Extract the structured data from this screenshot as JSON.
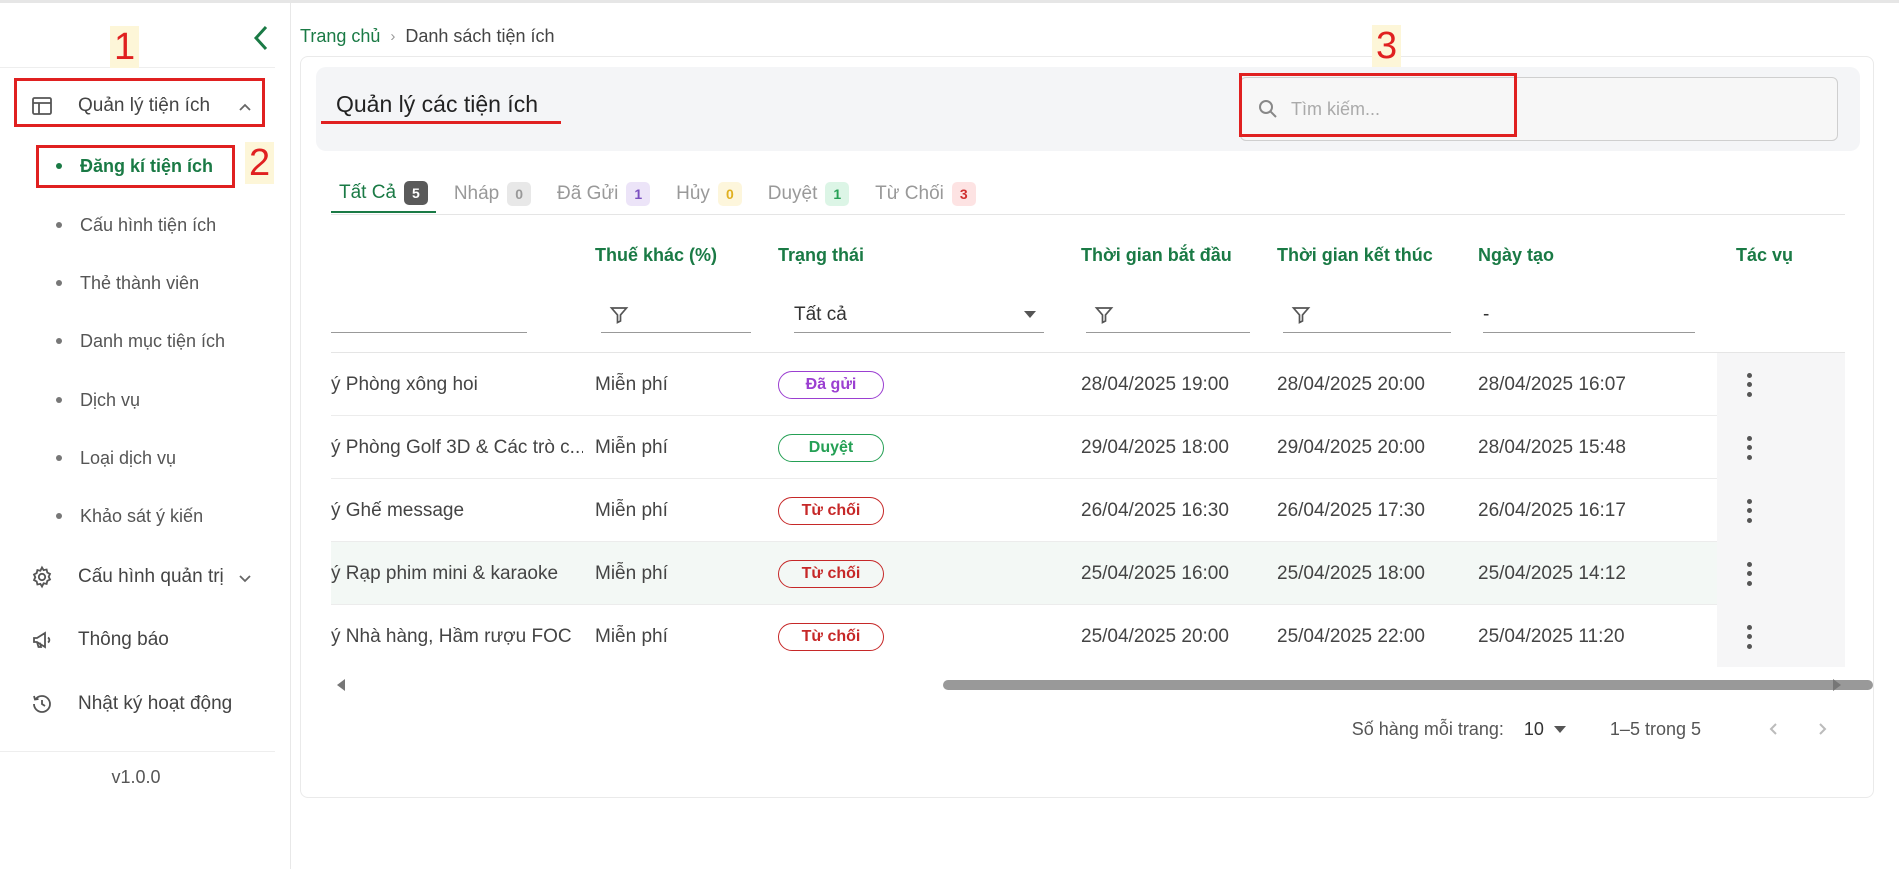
{
  "breadcrumb": {
    "home": "Trang chủ",
    "current": "Danh sách tiện ích"
  },
  "sidebar": {
    "menu_utility": "Quản lý tiện ích",
    "sub_items": [
      "Đăng kí tiện ích",
      "Cấu hình tiện ích",
      "Thẻ thành viên",
      "Danh mục tiện ích",
      "Dịch vụ",
      "Loại dịch vụ",
      "Khảo sát ý kiến"
    ],
    "menu_admin": "Cấu hình quản trị",
    "menu_notify": "Thông báo",
    "menu_log": "Nhật ký hoạt động",
    "version": "v1.0.0"
  },
  "annotations": [
    "1",
    "2",
    "3"
  ],
  "header": {
    "title": "Quản lý các tiện ích",
    "search_placeholder": "Tìm kiếm..."
  },
  "tabs": [
    {
      "label": "Tất Cả",
      "count": "5",
      "badge_bg": "#5a5a5a",
      "badge_fg": "#ffffff"
    },
    {
      "label": "Nháp",
      "count": "0",
      "badge_bg": "#e8e8e8",
      "badge_fg": "#999999"
    },
    {
      "label": "Đã Gửi",
      "count": "1",
      "badge_bg": "#ece4f8",
      "badge_fg": "#7b4fc0"
    },
    {
      "label": "Hủy",
      "count": "0",
      "badge_bg": "#fdf6dc",
      "badge_fg": "#e0b020"
    },
    {
      "label": "Duyệt",
      "count": "1",
      "badge_bg": "#dcf5e6",
      "badge_fg": "#25a055"
    },
    {
      "label": "Từ Chối",
      "count": "3",
      "badge_bg": "#fde3e3",
      "badge_fg": "#d03030"
    }
  ],
  "table": {
    "columns": [
      "Thuế khác (%)",
      "Trạng thái",
      "Thời gian bắt đầu",
      "Thời gian kết thúc",
      "Ngày tạo",
      "Tác vụ"
    ],
    "status_filter_value": "Tất cả",
    "created_filter_value": "-",
    "rows": [
      {
        "name": "ý Phòng xông hoi",
        "tax": "Miễn phí",
        "status": "Đã gửi",
        "status_class": "st-sent",
        "start": "28/04/2025 19:00",
        "end": "28/04/2025 20:00",
        "created": "28/04/2025 16:07"
      },
      {
        "name": "ý Phòng Golf 3D & Các trò c...",
        "tax": "Miễn phí",
        "status": "Duyệt",
        "status_class": "st-approved",
        "start": "29/04/2025 18:00",
        "end": "29/04/2025 20:00",
        "created": "28/04/2025 15:48"
      },
      {
        "name": "ý Ghế message",
        "tax": "Miễn phí",
        "status": "Từ chối",
        "status_class": "st-rejected",
        "start": "26/04/2025 16:30",
        "end": "26/04/2025 17:30",
        "created": "26/04/2025 16:17"
      },
      {
        "name": "ý Rạp phim mini & karaoke",
        "tax": "Miễn phí",
        "status": "Từ chối",
        "status_class": "st-rejected",
        "start": "25/04/2025 16:00",
        "end": "25/04/2025 18:00",
        "created": "25/04/2025 14:12"
      },
      {
        "name": "ý Nhà hàng, Hầm rượu FOC",
        "tax": "Miễn phí",
        "status": "Từ chối",
        "status_class": "st-rejected",
        "start": "25/04/2025 20:00",
        "end": "25/04/2025 22:00",
        "created": "25/04/2025 11:20"
      }
    ]
  },
  "pagination": {
    "rows_per_page_label": "Số hàng mỗi trang:",
    "rows_per_page": "10",
    "range": "1–5 trong 5"
  }
}
